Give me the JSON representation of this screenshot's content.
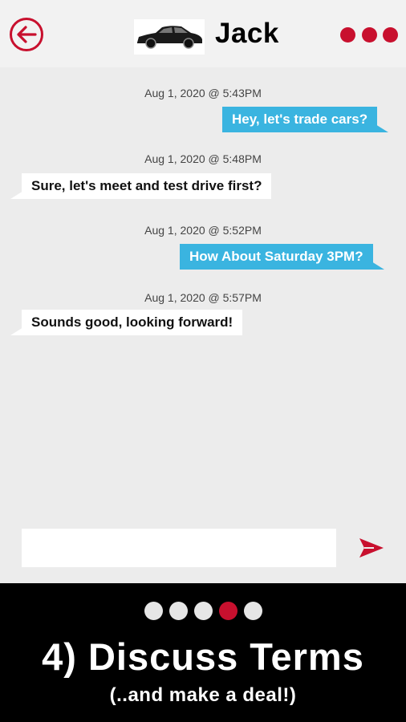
{
  "header": {
    "contact_name": "Jack",
    "back_icon": "arrow-left-circle-icon",
    "more_icon": "more-dots-icon",
    "accent_color": "#c8102e"
  },
  "messages": [
    {
      "timestamp": "Aug 1, 2020 @ 5:43PM",
      "text": "Hey, let's trade cars?",
      "direction": "outgoing"
    },
    {
      "timestamp": "Aug 1, 2020 @ 5:48PM",
      "text": "Sure, let's meet and test drive first?",
      "direction": "incoming"
    },
    {
      "timestamp": "Aug 1, 2020 @ 5:52PM",
      "text": "How About Saturday 3PM?",
      "direction": "outgoing"
    },
    {
      "timestamp": "Aug 1, 2020 @ 5:57PM",
      "text": "Sounds good, looking forward!",
      "direction": "incoming"
    }
  ],
  "composer": {
    "input_value": "",
    "send_icon": "send-icon"
  },
  "promo": {
    "page_count": 5,
    "active_page": 4,
    "title": "4) Discuss Terms",
    "subtitle": "(..and make a deal!)"
  }
}
